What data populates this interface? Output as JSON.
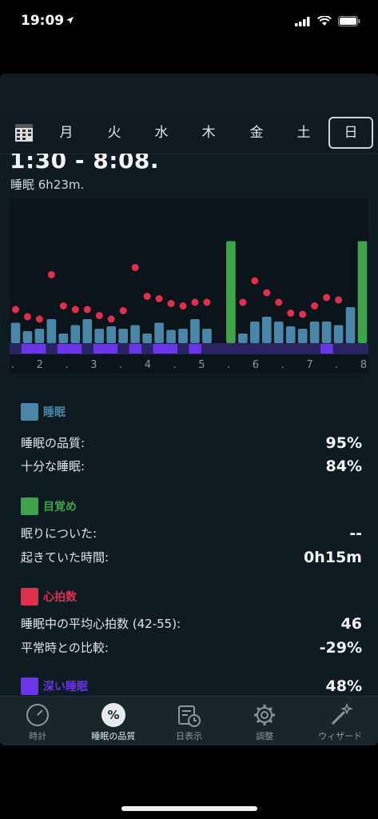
{
  "status": {
    "time": "19:09"
  },
  "days": [
    {
      "label": "月",
      "selected": false
    },
    {
      "label": "火",
      "selected": false
    },
    {
      "label": "水",
      "selected": false
    },
    {
      "label": "木",
      "selected": false
    },
    {
      "label": "金",
      "selected": false
    },
    {
      "label": "土",
      "selected": false
    },
    {
      "label": "日",
      "selected": true
    }
  ],
  "sleep_range": "1:30 - 8:08.",
  "sleep_duration": "睡眠 6h23m.",
  "colors": {
    "sleep": "#4a86a8",
    "awake": "#3fa34b",
    "heart": "#e0304f",
    "deep": "#6a35e6"
  },
  "chart_data": {
    "type": "bar",
    "x_ticks": [
      ".",
      "2",
      ".",
      "3",
      ".",
      "4",
      ".",
      "5",
      ".",
      "6",
      ".",
      "7",
      ".",
      "8"
    ],
    "series": [
      {
        "name": "睡眠",
        "values": [
          0.17,
          0.1,
          0.12,
          0.2,
          0.08,
          0.15,
          0.2,
          0.12,
          0.14,
          0.12,
          0.15,
          0.08,
          0.17,
          0.11,
          0.12,
          0.2,
          0.12,
          0.0,
          0.85,
          0.08,
          0.18,
          0.22,
          0.18,
          0.14,
          0.12,
          0.18,
          0.18,
          0.15,
          0.3,
          0.85
        ]
      },
      {
        "name": "目覚め",
        "values": [
          0,
          0,
          0,
          0,
          0,
          0,
          0,
          0,
          0,
          0,
          0,
          0,
          0,
          0,
          0,
          0,
          0,
          0,
          1,
          0,
          0,
          0,
          0,
          0,
          0,
          0,
          0,
          0,
          0,
          1
        ]
      },
      {
        "name": "心拍数",
        "values": [
          0.28,
          0.22,
          0.2,
          0.57,
          0.31,
          0.28,
          0.28,
          0.23,
          0.2,
          0.27,
          0.63,
          0.39,
          0.37,
          0.33,
          0.31,
          0.34,
          0.34,
          null,
          null,
          0.34,
          0.52,
          0.42,
          0.34,
          0.25,
          0.24,
          0.31,
          0.38,
          0.36,
          null,
          null
        ]
      },
      {
        "name": "深い睡眠",
        "values": [
          0,
          1,
          1,
          0,
          1,
          1,
          0,
          1,
          1,
          0,
          1,
          0,
          1,
          1,
          0,
          1,
          0,
          0,
          0,
          0,
          0,
          0,
          0,
          0,
          0,
          0,
          1,
          0,
          0,
          0
        ]
      }
    ]
  },
  "sections": {
    "sleep": {
      "title": "睡眠",
      "rows": [
        {
          "label": "睡眠の品質:",
          "value": "95%"
        },
        {
          "label": "十分な睡眠:",
          "value": "84%"
        }
      ]
    },
    "awake": {
      "title": "目覚め",
      "rows": [
        {
          "label": "眠りについた:",
          "value": "--"
        },
        {
          "label": "起きていた時間:",
          "value": "0h15m"
        }
      ]
    },
    "heart": {
      "title": "心拍数",
      "rows": [
        {
          "label": "睡眠中の平均心拍数 (42-55):",
          "value": "46"
        },
        {
          "label": "平常時との比較:",
          "value": "-29%"
        }
      ]
    },
    "deep": {
      "title": "深い睡眠",
      "value": "48%"
    }
  },
  "tabs": [
    {
      "label": "時計",
      "icon": "clock-icon"
    },
    {
      "label": "睡眠の品質",
      "icon": "percent-icon"
    },
    {
      "label": "日表示",
      "icon": "calendar-clock-icon"
    },
    {
      "label": "調整",
      "icon": "gear-icon"
    },
    {
      "label": "ウィザード",
      "icon": "magic-wand-icon"
    }
  ]
}
